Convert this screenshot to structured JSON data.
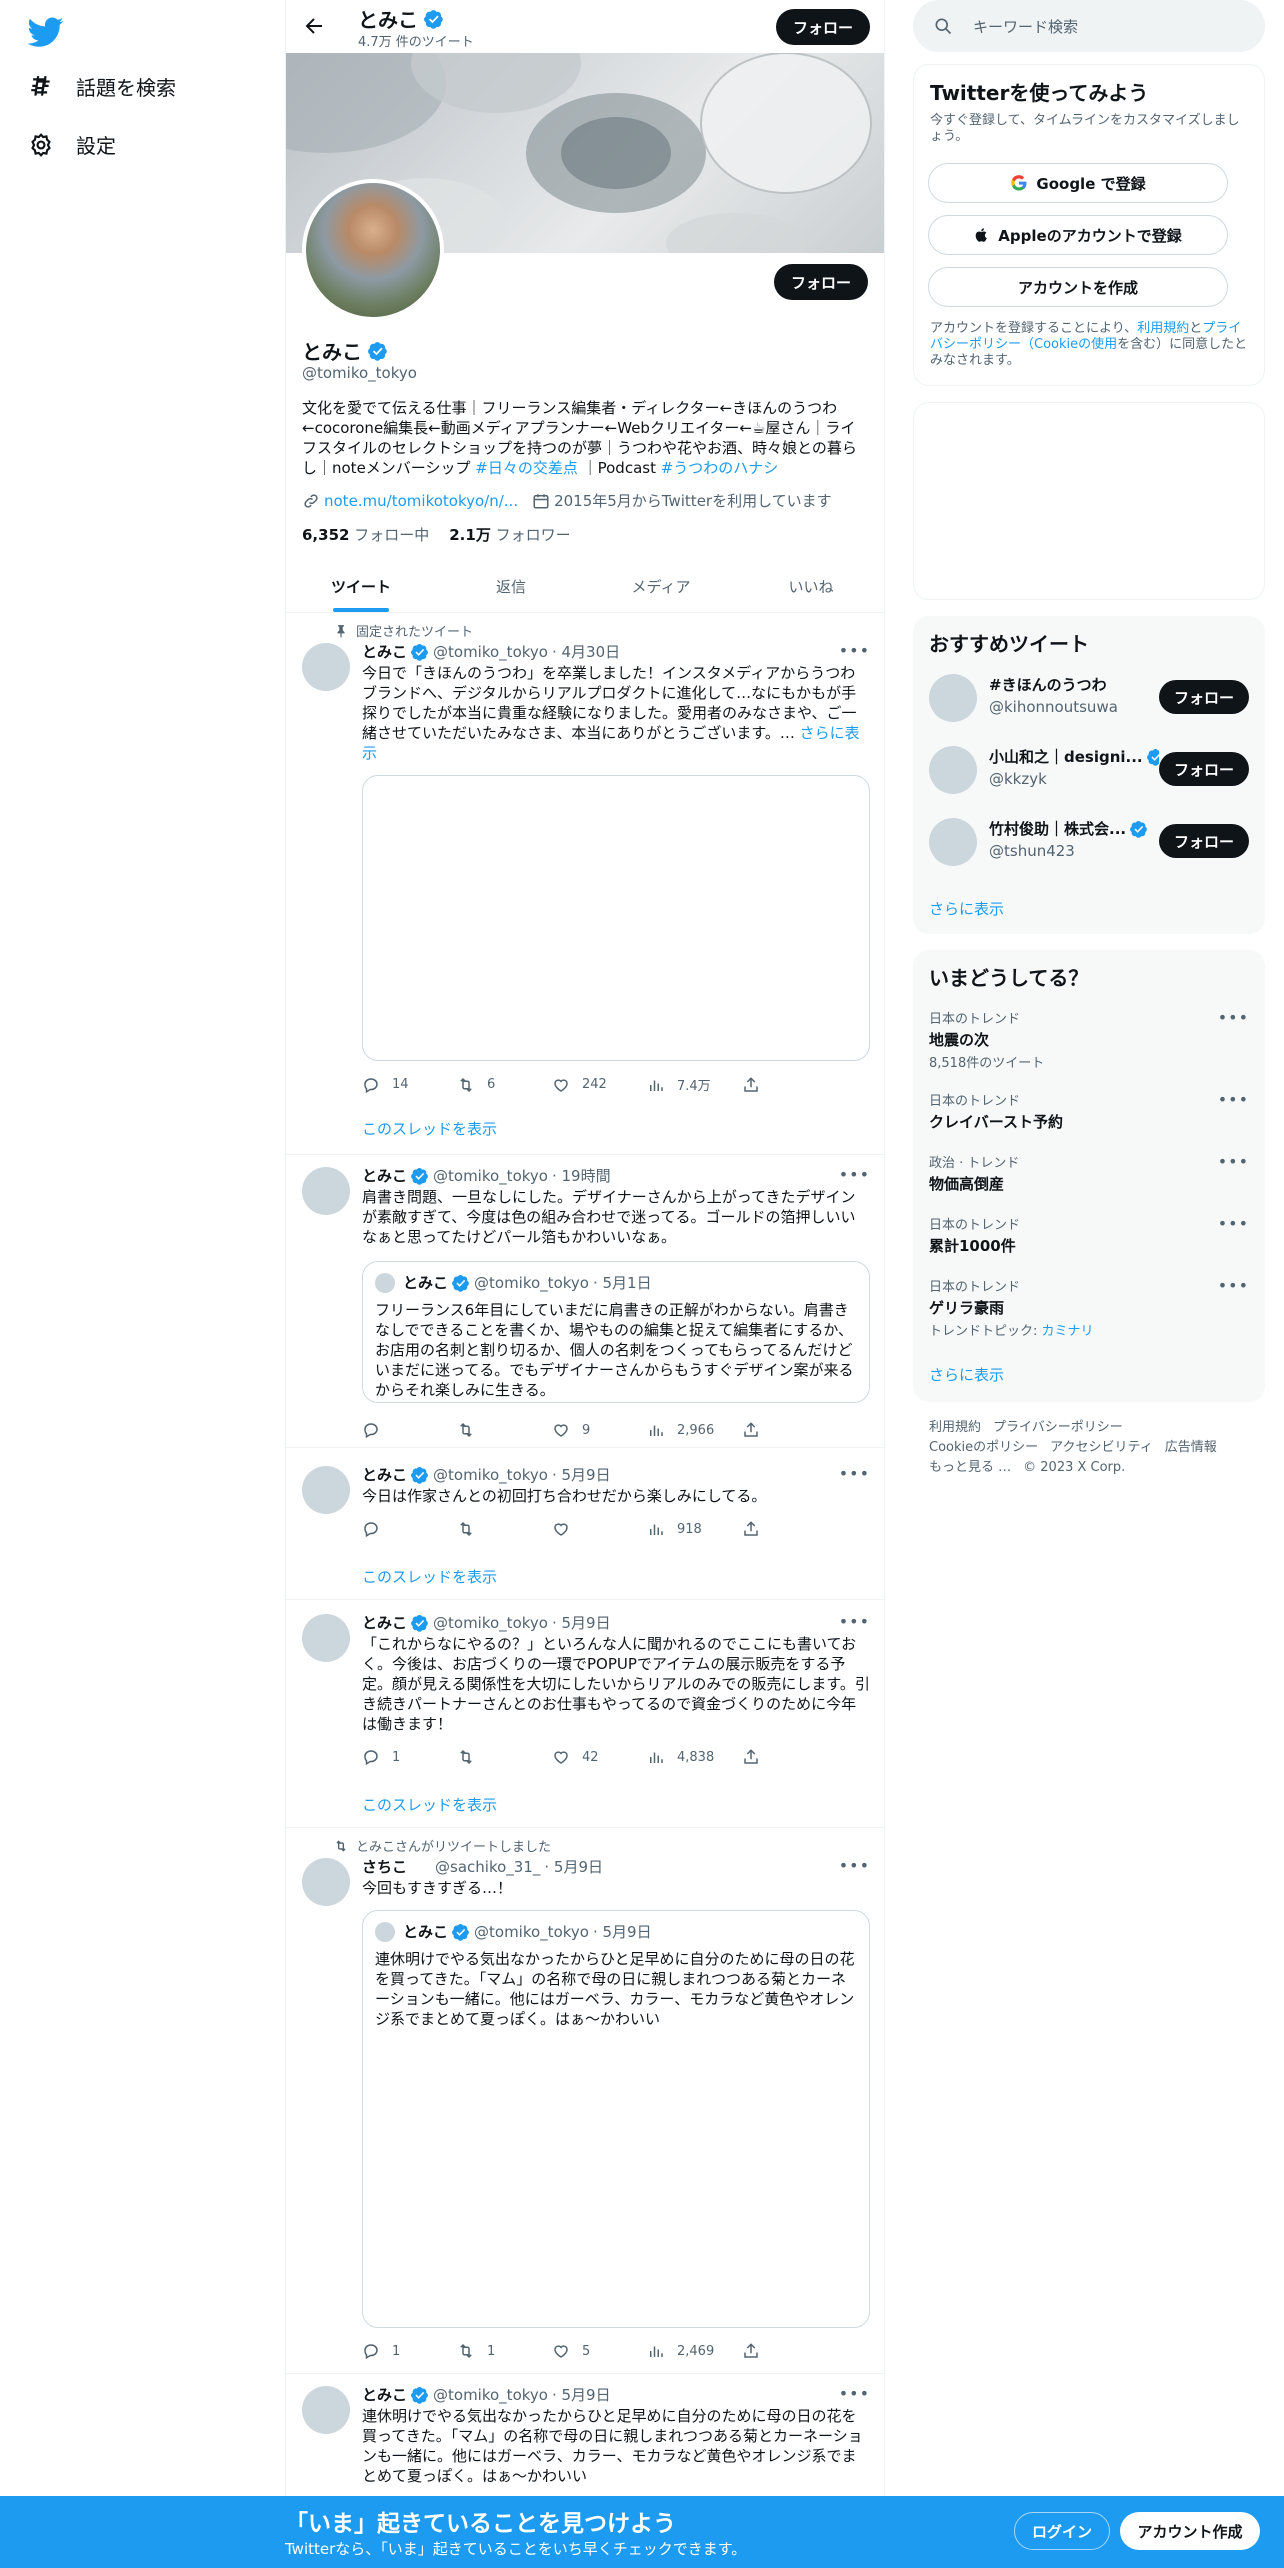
{
  "nav": {
    "explore_label": "話題を検索",
    "settings_label": "設定"
  },
  "header": {
    "name": "とみこ",
    "tweet_count": "4.7万 件のツイート",
    "follow_label": "フォロー"
  },
  "profile": {
    "name": "とみこ",
    "handle": "@tomiko_tokyo",
    "follow_label": "フォロー",
    "bio_main": "文化を愛でて伝える仕事｜フリーランス編集者・ディレクター←きほんのうつわ←cocorone編集長←動画メディアプランナー←Webクリエイター←☕屋さん｜ライフスタイルのセレクトショップを持つのが夢｜うつわや花やお酒、時々娘との暮らし｜noteメンバーシップ ",
    "bio_tag1": "#日々の交差点",
    "bio_mid": " ｜Podcast ",
    "bio_tag2": "#うつわのハナシ",
    "link": "note.mu/tomikotokyo/n/...",
    "joined": "2015年5月からTwitterを利用しています",
    "following_count": "6,352",
    "following_label": "フォロー中",
    "followers_count": "2.1万",
    "followers_label": "フォロワー"
  },
  "tabs": [
    "ツイート",
    "返信",
    "メディア",
    "いいね"
  ],
  "tweets": [
    {
      "context": "固定されたツイート",
      "name": "とみこ",
      "handle": "@tomiko_tokyo",
      "time": "· 4月30日",
      "text": "今日で「きほんのうつわ」を卒業しました！インスタメディアからうつわブランドへ、デジタルからリアルプロダクトに進化して…なにもかもが手探りでしたが本当に貴重な経験になりました。愛用者のみなさまや、ご一緒させていただいたみなさま、本当にありがとうございます。… ",
      "more": "さらに表示",
      "replies": "14",
      "retweets": "6",
      "likes": "242",
      "views": "7.4万",
      "thread": "このスレッドを表示"
    },
    {
      "name": "とみこ",
      "handle": "@tomiko_tokyo",
      "time": "· 19時間",
      "text": "肩書き問題、一旦なしにした。デザイナーさんから上がってきたデザインが素敵すぎて、今度は色の組み合わせで迷ってる。ゴールドの箔押しいいなぁと思ってたけどパール箔もかわいいなぁ。",
      "quote_name": "とみこ",
      "quote_handle": "@tomiko_tokyo",
      "quote_time": "· 5月1日",
      "quote_text": "フリーランス6年目にしていまだに肩書きの正解がわからない。肩書きなしでできることを書くか、場やものの編集と捉えて編集者にするか、お店用の名刺と割り切るか、個人の名刺をつくってもらってるんだけどいまだに迷ってる。でもデザイナーさんからもうすぐデザイン案が来るからそれ楽しみに生きる。",
      "replies": "",
      "retweets": "",
      "likes": "9",
      "views": "2,966"
    },
    {
      "name": "とみこ",
      "handle": "@tomiko_tokyo",
      "time": "· 5月9日",
      "text": "今日は作家さんとの初回打ち合わせだから楽しみにしてる。",
      "replies": "",
      "retweets": "",
      "likes": "",
      "views": "918",
      "thread": "このスレッドを表示"
    },
    {
      "name": "とみこ",
      "handle": "@tomiko_tokyo",
      "time": "· 5月9日",
      "text": "「これからなにやるの？」といろんな人に聞かれるのでここにも書いておく。今後は、お店づくりの一環でPOPUPでアイテムの展示販売をする予定。顔が見える関係性を大切にしたいからリアルのみでの販売にします。引き続きパートナーさんとのお仕事もやってるので資金づくりのために今年は働きます！",
      "replies": "1",
      "retweets": "",
      "likes": "42",
      "views": "4,838",
      "thread": "このスレッドを表示"
    },
    {
      "context": "とみこさんがリツイートしました",
      "name": "さちこ",
      "handle": "@sachiko_31_",
      "time": "· 5月9日",
      "text": "今回もすきすぎる…！",
      "quote_name": "とみこ",
      "quote_handle": "@tomiko_tokyo",
      "quote_time": "· 5月9日",
      "quote_text": "連休明けでやる気出なかったからひと足早めに自分のために母の日の花を買ってきた。「マム」の名称で母の日に親しまれつつある菊とカーネーションも一緒に。他にはガーベラ、カラー、モカラなど黄色やオレンジ系でまとめて夏っぽく。はぁ〜かわいい",
      "replies": "1",
      "retweets": "1",
      "likes": "5",
      "views": "2,469"
    },
    {
      "name": "とみこ",
      "handle": "@tomiko_tokyo",
      "time": "· 5月9日",
      "text": "連休明けでやる気出なかったからひと足早めに自分のために母の日の花を買ってきた。「マム」の名称で母の日に親しまれつつある菊とカーネーションも一緒に。他にはガーベラ、カラー、モカラなど黄色やオレンジ系でまとめて夏っぽく。はぁ〜かわいい"
    }
  ],
  "search": {
    "placeholder": "キーワード検索"
  },
  "signup": {
    "title": "Twitterを使ってみよう",
    "subtitle": "今すぐ登録して、タイムラインをカスタマイズしましょう。",
    "google": "Google で登録",
    "apple": "Appleのアカウントで登録",
    "create": "アカウントを作成",
    "terms_pre": "アカウントを登録することにより、",
    "terms_link1": "利用規約",
    "terms_and": "と",
    "terms_link2": "プライバシーポリシー",
    "terms_link3": "（Cookieの使用",
    "terms_post": "を含む）に同意したとみなされます。"
  },
  "recommended": {
    "title": "おすすめツイート",
    "follow_label": "フォロー",
    "items": [
      {
        "name": "#きほんのうつわ",
        "handle": "@kihonnoutsuwa",
        "verified": false
      },
      {
        "name": "小山和之｜designi...",
        "handle": "@kkzyk",
        "verified": true
      },
      {
        "name": "竹村俊助｜株式会...",
        "handle": "@tshun423",
        "verified": true
      }
    ],
    "show_more": "さらに表示"
  },
  "trends": {
    "title": "いまどうしてる？",
    "items": [
      {
        "meta": "日本のトレンド",
        "name": "地震の次",
        "sub": "8,518件のツイート"
      },
      {
        "meta": "日本のトレンド",
        "name": "クレイバースト予約",
        "sub": ""
      },
      {
        "meta": "政治 · トレンド",
        "name": "物価高倒産",
        "sub": ""
      },
      {
        "meta": "日本のトレンド",
        "name": "累計1000件",
        "sub": ""
      },
      {
        "meta": "日本のトレンド",
        "name": "ゲリラ豪雨",
        "sub_pre": "トレンドトピック: ",
        "sub_link": "カミナリ"
      }
    ],
    "show_more": "さらに表示"
  },
  "footer": {
    "links": [
      "利用規約",
      "プライバシーポリシー",
      "Cookieのポリシー",
      "アクセシビリティ",
      "広告情報",
      "もっと見る …",
      "© 2023 X Corp."
    ]
  },
  "bottom": {
    "title": "「いま」起きていることを見つけよう",
    "subtitle": "Twitterなら、「いま」起きていることをいち早くチェックできます。",
    "login": "ログイン",
    "signup": "アカウント作成"
  },
  "colors": {
    "accent": "#1d9bf0",
    "text": "#0f1419",
    "secondary": "#536471"
  }
}
